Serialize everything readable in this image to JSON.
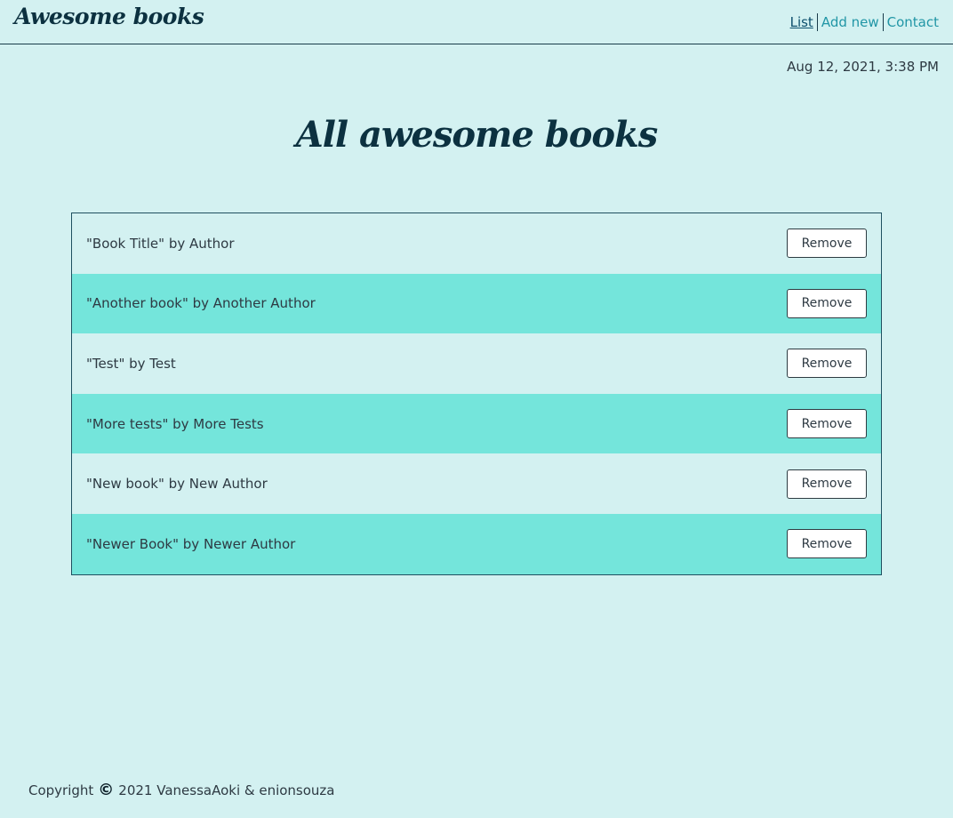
{
  "header": {
    "logo": "Awesome books",
    "nav": [
      {
        "label": "List",
        "active": true
      },
      {
        "label": "Add new",
        "active": false
      },
      {
        "label": "Contact",
        "active": false
      }
    ]
  },
  "date": "Aug 12, 2021, 3:38 PM",
  "main": {
    "title": "All awesome books",
    "remove_label": "Remove",
    "books": [
      {
        "text": "\"Book Title\" by Author"
      },
      {
        "text": "\"Another book\" by Another Author"
      },
      {
        "text": "\"Test\" by Test"
      },
      {
        "text": "\"More tests\" by More Tests"
      },
      {
        "text": "\"New book\" by New Author"
      },
      {
        "text": "\"Newer Book\" by Newer Author"
      }
    ]
  },
  "footer": {
    "prefix": "Copyright",
    "copyright_icon": "copyright-icon",
    "suffix": "2021 VanessaAoki & enionsouza"
  },
  "colors": {
    "background": "#d3f1f1",
    "row_alt": "#74e5db",
    "heading": "#0c3140",
    "link": "#2196a6",
    "link_active": "#0d4f6d"
  }
}
